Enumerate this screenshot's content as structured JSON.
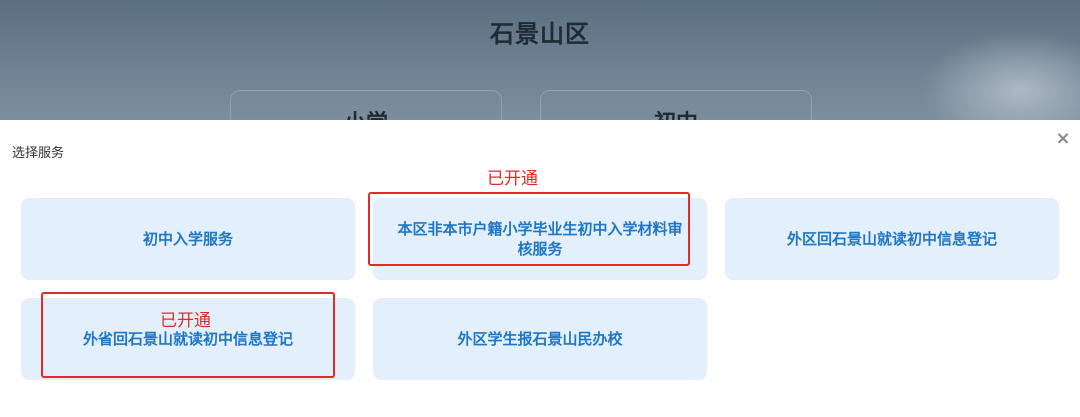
{
  "background": {
    "title": "石景山区",
    "cards": [
      "小学",
      "初中"
    ]
  },
  "modal": {
    "title": "选择服务",
    "close_label": "×",
    "services": [
      {
        "label": "初中入学服务"
      },
      {
        "label": "本区非本市户籍小学毕业生初中入学材料审核服务"
      },
      {
        "label": "外区回石景山就读初中信息登记"
      },
      {
        "label": "外省回石景山就读初中信息登记"
      },
      {
        "label": "外区学生报石景山民办校"
      }
    ],
    "annotations": [
      "已开通",
      "已开通"
    ]
  },
  "colors": {
    "card_bg": "#e3f0fb",
    "card_text": "#1f76c6",
    "annotation": "#e12a2a"
  }
}
